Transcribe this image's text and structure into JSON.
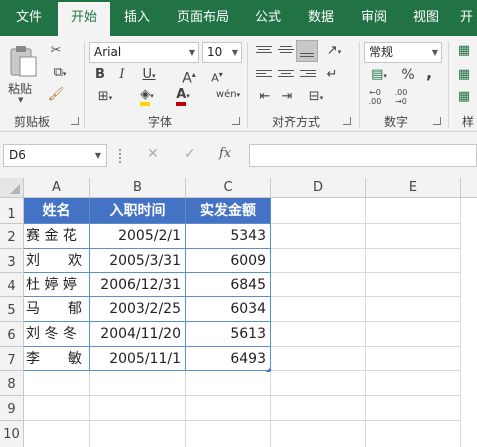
{
  "ribbon": {
    "tabs": [
      {
        "label": "文件"
      },
      {
        "label": "开始"
      },
      {
        "label": "插入"
      },
      {
        "label": "页面布局"
      },
      {
        "label": "公式"
      },
      {
        "label": "数据"
      },
      {
        "label": "审阅"
      },
      {
        "label": "视图"
      },
      {
        "label": "开"
      }
    ],
    "clipboard": {
      "paste_label": "粘贴",
      "group_label": "剪贴板"
    },
    "font": {
      "name": "Arial",
      "size": "10",
      "group_label": "字体"
    },
    "alignment": {
      "group_label": "对齐方式"
    },
    "number": {
      "format": "常规",
      "group_label": "数字",
      "percent": "%",
      "comma": ","
    },
    "extra_group_label": "样"
  },
  "formula_bar": {
    "name_box": "D6",
    "fx_label": "fx",
    "formula": ""
  },
  "sheet": {
    "columns": [
      "A",
      "B",
      "C",
      "D",
      "E"
    ],
    "rows": [
      "1",
      "2",
      "3",
      "4",
      "5",
      "6",
      "7",
      "8",
      "9",
      "10"
    ],
    "table_headers": [
      "姓名",
      "入职时间",
      "实发金额"
    ],
    "data": [
      {
        "name": "赛 金 花",
        "date": "2005/2/1",
        "amount": "5343"
      },
      {
        "name": "刘　　欢",
        "date": "2005/3/31",
        "amount": "6009"
      },
      {
        "name": "杜 婷 婷",
        "date": "2006/12/31",
        "amount": "6845"
      },
      {
        "name": "马　　郁",
        "date": "2003/2/25",
        "amount": "6034"
      },
      {
        "name": "刘 冬 冬",
        "date": "2004/11/20",
        "amount": "5613"
      },
      {
        "name": "李　　敏",
        "date": "2005/11/1",
        "amount": "6493"
      }
    ],
    "header_color": "#4472c4"
  }
}
